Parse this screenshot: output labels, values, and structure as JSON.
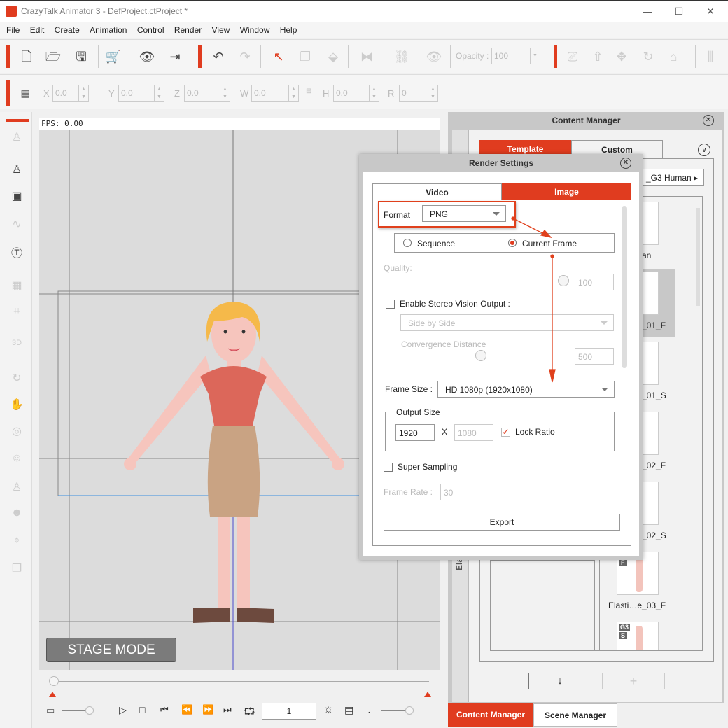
{
  "window": {
    "title": "CrazyTalk Animator 3   - DefProject.ctProject *",
    "minimize": "—",
    "maximize": "☐",
    "close": "✕"
  },
  "menu": [
    "File",
    "Edit",
    "Create",
    "Animation",
    "Control",
    "Render",
    "View",
    "Window",
    "Help"
  ],
  "toolbar": {
    "opacity_label": "Opacity :",
    "opacity_value": "100"
  },
  "transform": {
    "x_label": "X",
    "x": "0.0",
    "y_label": "Y",
    "y": "0.0",
    "z_label": "Z",
    "z": "0.0",
    "w_label": "W",
    "w": "0.0",
    "h_label": "H",
    "h": "0.0",
    "r_label": "R",
    "r": "0"
  },
  "stage": {
    "fps": "FPS: 0.00",
    "mode": "STAGE MODE"
  },
  "timeline": {
    "frame": "1"
  },
  "content_manager": {
    "title": "Content Manager",
    "tabs": [
      "Template",
      "Custom"
    ],
    "active_tab": "Template",
    "folder": "_G3 Human",
    "side_tab": "Elastic",
    "items": [
      "an",
      "_01_F",
      "_01_S",
      "_02_F",
      "_02_S",
      "Elasti…e_03_F"
    ],
    "badges": {
      "item6": "F",
      "item7_a": "G3",
      "item7_b": "S"
    },
    "download_icon": "↓",
    "add_icon": "+"
  },
  "bottom_tabs": [
    "Content Manager",
    "Scene Manager"
  ],
  "render_settings": {
    "title": "Render Settings",
    "tabs": [
      "Video",
      "Image"
    ],
    "active_tab": "Image",
    "format_label": "Format",
    "format_value": "PNG",
    "range_options": [
      "Sequence",
      "Current Frame"
    ],
    "range_selected": "Current Frame",
    "quality_label": "Quality:",
    "quality_value": "100",
    "stereo_label": "Enable Stereo Vision Output :",
    "stereo_checked": false,
    "stereo_mode": "Side by Side",
    "convergence_label": "Convergence Distance",
    "convergence_value": "500",
    "frame_size_label": "Frame Size :",
    "frame_size_value": "HD 1080p (1920x1080)",
    "output_size_label": "Output Size",
    "width": "1920",
    "x_sep": "X",
    "height": "1080",
    "lock_ratio_label": "Lock Ratio",
    "lock_ratio_checked": true,
    "super_sampling_label": "Super Sampling",
    "super_sampling_checked": false,
    "frame_rate_label": "Frame Rate :",
    "frame_rate_value": "30",
    "export_label": "Export"
  },
  "colors": {
    "accent": "#e03c1f",
    "annotation": "#e0401c"
  }
}
